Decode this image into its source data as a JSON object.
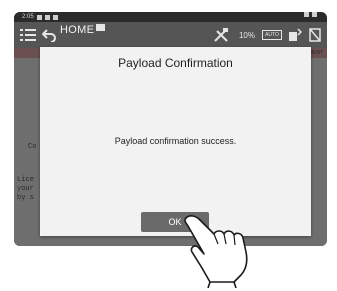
{
  "status_bar": {
    "time": "2:05"
  },
  "toolbar": {
    "home_label": "HOME",
    "battery_percent": "10%",
    "auto_label": "AUTO",
    "icons": [
      "menu-icon",
      "back-icon",
      "tools-icon",
      "auto-icon",
      "upload-icon",
      "no-signal-icon"
    ]
  },
  "background": {
    "tab_right": "MENT",
    "line1": "Co",
    "line2": "Lice",
    "line3": "your",
    "line4": "by s"
  },
  "dialog": {
    "title": "Payload Confirmation",
    "message": "Payload confirmation success.",
    "ok_label": "OK"
  },
  "colors": {
    "dialog_bg": "#f2f2f2",
    "button_bg": "#6a6a6a",
    "toolbar_bg": "#555555"
  }
}
